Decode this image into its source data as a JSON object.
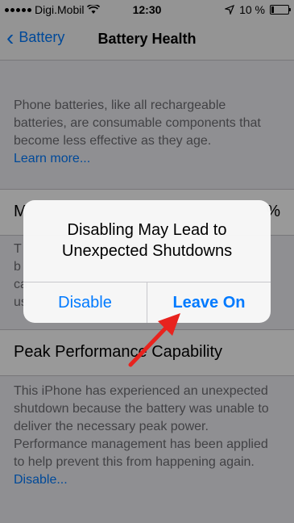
{
  "status_bar": {
    "carrier": "Digi.Mobil",
    "time": "12:30",
    "battery_percent": "10 %"
  },
  "nav": {
    "back_label": "Battery",
    "title": "Battery Health"
  },
  "intro": {
    "text": "Phone batteries, like all rechargeable batteries, are consumable components that become less effective as they age.",
    "link": "Learn more..."
  },
  "max_capacity": {
    "label_partial": "M",
    "value_partial": "%"
  },
  "hidden_desc_partial": [
    "T",
    "b",
    "ca",
    "us"
  ],
  "peak": {
    "label": "Peak Performance Capability"
  },
  "peak_desc": {
    "text": "This iPhone has experienced an unexpected shutdown because the battery was unable to deliver the necessary peak power. Performance management has been applied to help prevent this from happening again.",
    "link": "Disable..."
  },
  "alert": {
    "title": "Disabling May Lead to Unexpected Shutdowns",
    "disable_label": "Disable",
    "leave_on_label": "Leave On"
  },
  "colors": {
    "accent": "#007aff",
    "annotation_arrow": "#e8231e"
  },
  "icons": [
    "signal-icon",
    "wifi-icon",
    "location-arrow-icon",
    "battery-icon",
    "back-chevron-icon",
    "annotation-arrow-icon"
  ]
}
